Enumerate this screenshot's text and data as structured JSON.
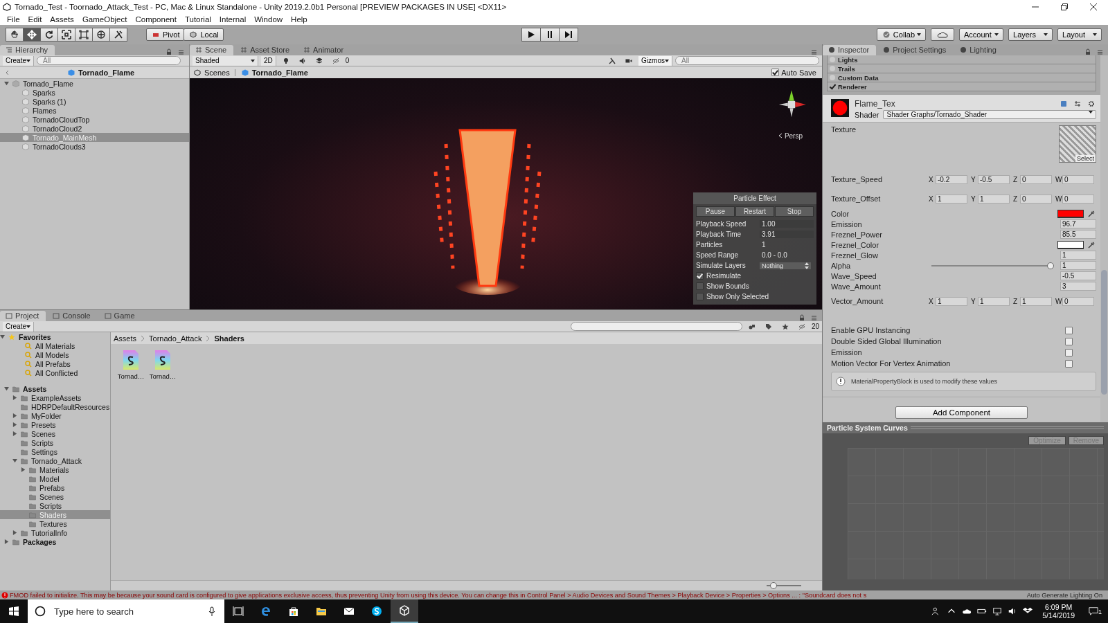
{
  "window": {
    "title": "Tornado_Test - Toornado_Attack_Test - PC, Mac & Linux Standalone - Unity 2019.2.0b1 Personal [PREVIEW PACKAGES IN USE] <DX11>"
  },
  "menu": [
    "File",
    "Edit",
    "Assets",
    "GameObject",
    "Component",
    "Tutorial",
    "Internal",
    "Window",
    "Help"
  ],
  "toolbar": {
    "tools": [
      {
        "kind": "hand",
        "selected": false
      },
      {
        "kind": "move",
        "selected": true
      },
      {
        "kind": "rotate",
        "selected": false
      },
      {
        "kind": "scale",
        "selected": false
      },
      {
        "kind": "rect",
        "selected": false
      },
      {
        "kind": "transform",
        "selected": false
      },
      {
        "kind": "custom",
        "selected": false
      }
    ],
    "pivot": "Pivot",
    "local": "Local",
    "collab": "Collab",
    "account": "Account",
    "layers": "Layers",
    "layout": "Layout"
  },
  "hierarchy": {
    "tab": "Hierarchy",
    "create": "Create",
    "search_placeholder": "All",
    "scene": "Tornado_Flame",
    "tree": [
      {
        "label": "Tornado_Flame",
        "expanded": true,
        "selected": false,
        "children": [
          {
            "label": "Sparks",
            "selected": false
          },
          {
            "label": "Sparks (1)",
            "selected": false
          },
          {
            "label": "Flames",
            "selected": false
          },
          {
            "label": "TornadoCloudTop",
            "selected": false
          },
          {
            "label": "TornadoCloud2",
            "selected": false
          },
          {
            "label": "Tornado_MainMesh",
            "selected": true
          },
          {
            "label": "TornadoClouds3",
            "selected": false
          }
        ]
      }
    ]
  },
  "scene_view": {
    "tabs": [
      {
        "label": "Scene",
        "selected": true
      },
      {
        "label": "Asset Store",
        "selected": false
      },
      {
        "label": "Animator",
        "selected": false
      }
    ],
    "shading": "Shaded",
    "mode_2d": "2D",
    "hidden_count": "0",
    "gizmos": "Gizmos",
    "search_placeholder": "All",
    "breadcrumb": [
      "Scenes",
      "Tornado_Flame"
    ],
    "auto_save": {
      "label": "Auto Save",
      "checked": true
    },
    "projection": "Persp",
    "particle_effect": {
      "title": "Particle Effect",
      "buttons": [
        "Pause",
        "Restart",
        "Stop"
      ],
      "fields": [
        {
          "label": "Playback Speed",
          "value": "1.00",
          "kind": "field"
        },
        {
          "label": "Playback Time",
          "value": "3.91",
          "kind": "field"
        },
        {
          "label": "Particles",
          "value": "1",
          "kind": "text"
        },
        {
          "label": "Speed Range",
          "value": "0.0 - 0.0",
          "kind": "text"
        },
        {
          "label": "Simulate Layers",
          "value": "Nothing",
          "kind": "dropdown"
        }
      ],
      "options": [
        {
          "label": "Resimulate",
          "checked": true
        },
        {
          "label": "Show Bounds",
          "checked": false
        },
        {
          "label": "Show Only Selected",
          "checked": false
        }
      ]
    }
  },
  "inspector": {
    "tabs": [
      {
        "label": "Inspector",
        "selected": true
      },
      {
        "label": "Project Settings",
        "selected": false
      },
      {
        "label": "Lighting",
        "selected": false
      }
    ],
    "modules": [
      {
        "label": "Lights",
        "enabled": false
      },
      {
        "label": "Trails",
        "enabled": false
      },
      {
        "label": "Custom Data",
        "enabled": false
      },
      {
        "label": "Renderer",
        "enabled": true
      }
    ],
    "material": {
      "name": "Flame_Tex",
      "shader_label": "Shader",
      "shader": "Shader Graphs/Tornado_Shader"
    },
    "properties": [
      {
        "kind": "texture",
        "label": "Texture",
        "select": "Select"
      },
      {
        "kind": "vector",
        "label": "Texture_Speed",
        "components": [
          {
            "axis": "X",
            "value": "-0.2"
          },
          {
            "axis": "Y",
            "value": "-0.5"
          },
          {
            "axis": "Z",
            "value": "0"
          },
          {
            "axis": "W",
            "value": "0"
          }
        ]
      },
      {
        "kind": "vector",
        "label": "Texture_Offset",
        "components": [
          {
            "axis": "X",
            "value": "1"
          },
          {
            "axis": "Y",
            "value": "1"
          },
          {
            "axis": "Z",
            "value": "0"
          },
          {
            "axis": "W",
            "value": "0"
          }
        ]
      },
      {
        "kind": "color",
        "label": "Color",
        "color": "#ff0000"
      },
      {
        "kind": "float",
        "label": "Emission",
        "value": "96.7"
      },
      {
        "kind": "float",
        "label": "Freznel_Power",
        "value": "85.5"
      },
      {
        "kind": "color",
        "label": "Freznel_Color",
        "color": "#ffffff"
      },
      {
        "kind": "float",
        "label": "Freznel_Glow",
        "value": "1"
      },
      {
        "kind": "slider",
        "label": "Alpha",
        "level": 1,
        "value": "1"
      },
      {
        "kind": "float",
        "label": "Wave_Speed",
        "value": "-0.5"
      },
      {
        "kind": "float",
        "label": "Wave_Amount",
        "value": "3"
      },
      {
        "kind": "vector",
        "label": "Vector_Amount",
        "components": [
          {
            "axis": "X",
            "value": "1"
          },
          {
            "axis": "Y",
            "value": "1"
          },
          {
            "axis": "Z",
            "value": "1"
          },
          {
            "axis": "W",
            "value": "0"
          }
        ]
      }
    ],
    "options": [
      {
        "label": "Enable GPU Instancing",
        "checked": false
      },
      {
        "label": "Double Sided Global Illumination",
        "checked": false
      },
      {
        "label": "Emission",
        "checked": false
      },
      {
        "label": "Motion Vector For Vertex Animation",
        "checked": false
      }
    ],
    "note": "MaterialPropertyBlock is used to modify these values",
    "add_component": "Add Component"
  },
  "curves": {
    "title": "Particle System Curves",
    "buttons": [
      "Optimize",
      "Remove"
    ]
  },
  "project": {
    "tabs": [
      {
        "label": "Project",
        "selected": true
      },
      {
        "label": "Console",
        "selected": false
      },
      {
        "label": "Game",
        "selected": false
      }
    ],
    "create": "Create",
    "hidden_count": "20",
    "favorites": {
      "label": "Favorites",
      "expanded": true,
      "items": [
        {
          "label": "All Materials",
          "selected": false
        },
        {
          "label": "All Models",
          "selected": false
        },
        {
          "label": "All Prefabs",
          "selected": false
        },
        {
          "label": "All Conflicted",
          "selected": false
        }
      ]
    },
    "folders": [
      {
        "label": "Assets",
        "expanded": true,
        "selected": false,
        "children": [
          {
            "label": "ExampleAssets",
            "expanded": false,
            "selected": false
          },
          {
            "label": "HDRPDefaultResources",
            "selected": false
          },
          {
            "label": "MyFolder",
            "expanded": false,
            "selected": false
          },
          {
            "label": "Presets",
            "expanded": false,
            "selected": false
          },
          {
            "label": "Scenes",
            "expanded": false,
            "selected": false
          },
          {
            "label": "Scripts",
            "selected": false
          },
          {
            "label": "Settings",
            "selected": false
          },
          {
            "label": "Tornado_Attack",
            "expanded": true,
            "selected": false,
            "children": [
              {
                "label": "Materials",
                "expanded": false,
                "selected": false
              },
              {
                "label": "Model",
                "selected": false
              },
              {
                "label": "Prefabs",
                "selected": false
              },
              {
                "label": "Scenes",
                "selected": false
              },
              {
                "label": "Scripts",
                "selected": false
              },
              {
                "label": "Shaders",
                "selected": true
              },
              {
                "label": "Textures",
                "selected": false
              }
            ]
          },
          {
            "label": "TutorialInfo",
            "expanded": false,
            "selected": false
          }
        ]
      },
      {
        "label": "Packages",
        "expanded": false,
        "selected": false
      }
    ],
    "breadcrumb": [
      "Assets",
      "Tornado_Attack",
      "Shaders"
    ],
    "files": [
      {
        "label": "Tornad…"
      },
      {
        "label": "Tornad…"
      }
    ],
    "zoom": {
      "level": 0.2
    }
  },
  "status": {
    "message": "FMOD failed to initialize. This may be because your sound card is configured to give applications exclusive access, thus preventing Unity from using this device. You can change this in Control Panel > Audio Devices and Sound Themes > Playback Device > Properties > Options ... : \"Soundcard does not s",
    "lighting": "Auto Generate Lighting On"
  },
  "taskbar": {
    "search_placeholder": "Type here to search",
    "time": "6:09 PM",
    "date": "5/14/2019",
    "notifications": "1"
  }
}
